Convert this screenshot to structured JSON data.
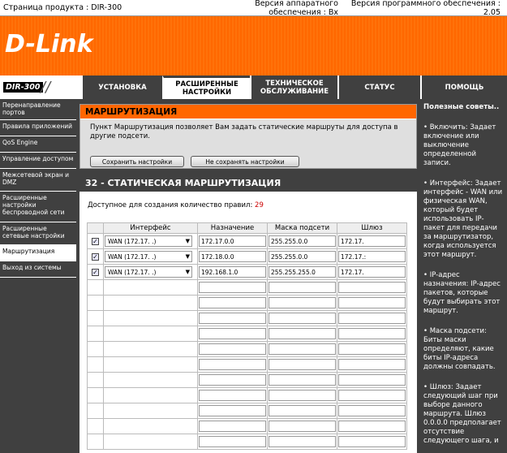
{
  "header": {
    "product": "Страница продукта :  DIR-300",
    "hw": "Версия аппаратного обеспечения : Bx",
    "sw": "Версия программного обеспечения : 2.05"
  },
  "brand": {
    "logo": "D-Link",
    "model": "DIR-300"
  },
  "nav": [
    {
      "label": "УСТАНОВКА"
    },
    {
      "label": "РАСШИРЕННЫЕ НАСТРОЙКИ"
    },
    {
      "label": "ТЕХНИЧЕСКОЕ ОБСЛУЖИВАНИЕ"
    },
    {
      "label": "СТАТУС"
    },
    {
      "label": "ПОМОЩЬ"
    }
  ],
  "sidebar": [
    {
      "label": "Перенаправление портов"
    },
    {
      "label": "Правила приложений"
    },
    {
      "label": "QoS Engine"
    },
    {
      "label": "Управление доступом"
    },
    {
      "label": "Межсетевой экран и DMZ"
    },
    {
      "label": "Расширенные настройки беспроводной сети"
    },
    {
      "label": "Расширенные сетевые настройки"
    },
    {
      "label": "Маршрутизация"
    },
    {
      "label": "Выход из системы"
    }
  ],
  "routing": {
    "title": "МАРШРУТИЗАЦИЯ",
    "description": "Пункт Маршрутизация позволяет Вам задать статические маршруты для доступа в другие подсети.",
    "save": "Сохранить настройки",
    "nosave": "Не сохранять настройки"
  },
  "static": {
    "title": "32 - СТАТИЧЕСКАЯ МАРШРУТИЗАЦИЯ",
    "avail_label": "Доступное для создания количество правил:",
    "avail_count": "29",
    "cols": {
      "iface": "Интерфейс",
      "dest": "Назначение",
      "mask": "Маска подсети",
      "gw": "Шлюз"
    },
    "rows": [
      {
        "checked": "✓",
        "iface": "WAN (172.17.        .)",
        "dest": "172.17.0.0",
        "mask": "255.255.0.0",
        "gw": "172.17."
      },
      {
        "checked": "✓",
        "iface": "WAN (172.17.        .)",
        "dest": "172.18.0.0",
        "mask": "255.255.0.0",
        "gw": "172.17.:"
      },
      {
        "checked": "✓",
        "iface": "WAN (172.17.        .)",
        "dest": "192.168.1.0",
        "mask": "255.255.255.0",
        "gw": "172.17."
      }
    ]
  },
  "help": {
    "title": "Полезные советы..",
    "tips": [
      "• Включить: Задает включение или выключение определенной записи.",
      "• Интерфейс: Задает интерфейс - WAN или физическая WAN, который будет использовать IP-пакет для передачи за маршрутизатор, когда используется этот маршрут.",
      "• IP-адрес назначения: IP-адрес пакетов, которые будут выбирать этот маршрут.",
      "• Маска подсети: Биты маски определяют, какие биты IP-адреса должны совпадать.",
      "• Шлюз: Задает следующий шаг при выборе данного маршрута. Шлюз 0.0.0.0 предполагает отсутствие следующего шага, и"
    ]
  }
}
